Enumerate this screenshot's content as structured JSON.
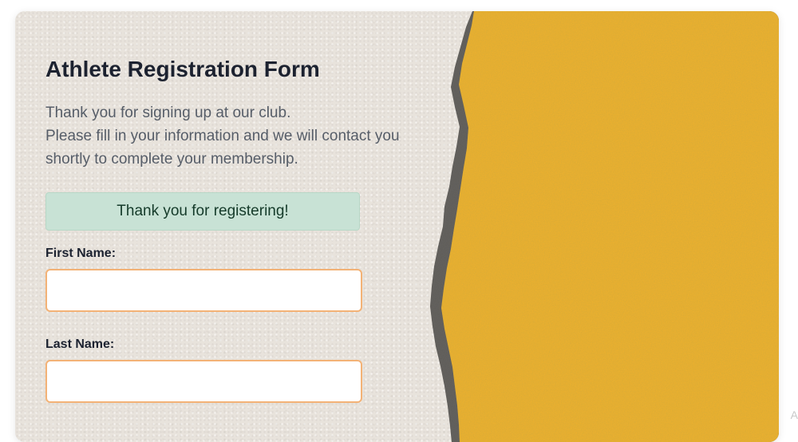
{
  "form": {
    "title": "Athlete Registration Form",
    "intro_lines": [
      "Thank you for signing up at our club.",
      "Please fill in your information and we will contact you",
      "shortly to complete your membership."
    ],
    "success_message": "Thank you for registering!",
    "fields": {
      "first_name": {
        "label": "First Name:",
        "value": ""
      },
      "last_name": {
        "label": "Last Name:",
        "value": ""
      }
    }
  },
  "colors": {
    "paper": "#e8e3dc",
    "panel_yellow": "#f0b12c",
    "torn_edge": "#5d5a55",
    "success_bg": "#c8e2d5",
    "input_border": "#f3b276",
    "title_text": "#1c2230"
  },
  "edge_mark": "A"
}
